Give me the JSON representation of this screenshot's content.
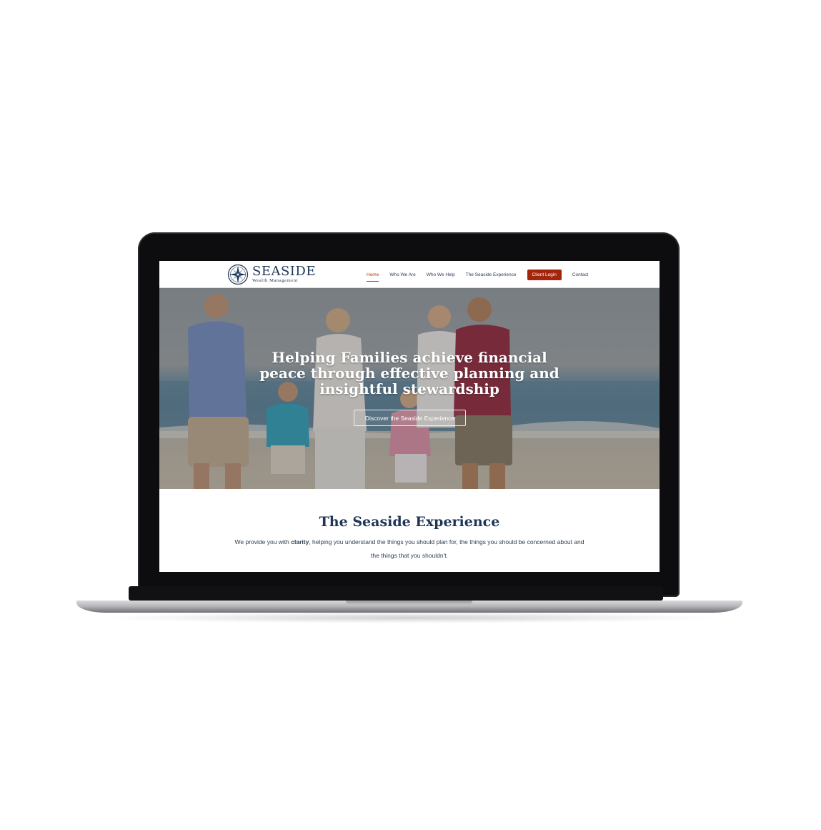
{
  "site": {
    "logo": {
      "name": "SEASIDE",
      "subtitle": "Wealth Management",
      "icon": "compass-rose-icon",
      "color": "#1e3556"
    },
    "nav": {
      "items": [
        {
          "label": "Home",
          "active": true
        },
        {
          "label": "Who We Are",
          "active": false
        },
        {
          "label": "Who We Help",
          "active": false
        },
        {
          "label": "The Seaside Experience",
          "active": false
        }
      ],
      "cta_label": "Client Login",
      "contact_label": "Contact",
      "active_color": "#b23a14",
      "cta_color": "#a5250c"
    },
    "hero": {
      "heading": "Helping Families achieve financial peace through effective planning and insightful stewardship",
      "button_label": "Discover the Seaside Experience"
    },
    "experience": {
      "title": "The Seaside Experience",
      "text_before": "We provide you with ",
      "text_bold": "clarity",
      "text_after": ", helping you understand the things  you should plan for, the things you should be concerned about and the things that you shouldn't."
    }
  }
}
